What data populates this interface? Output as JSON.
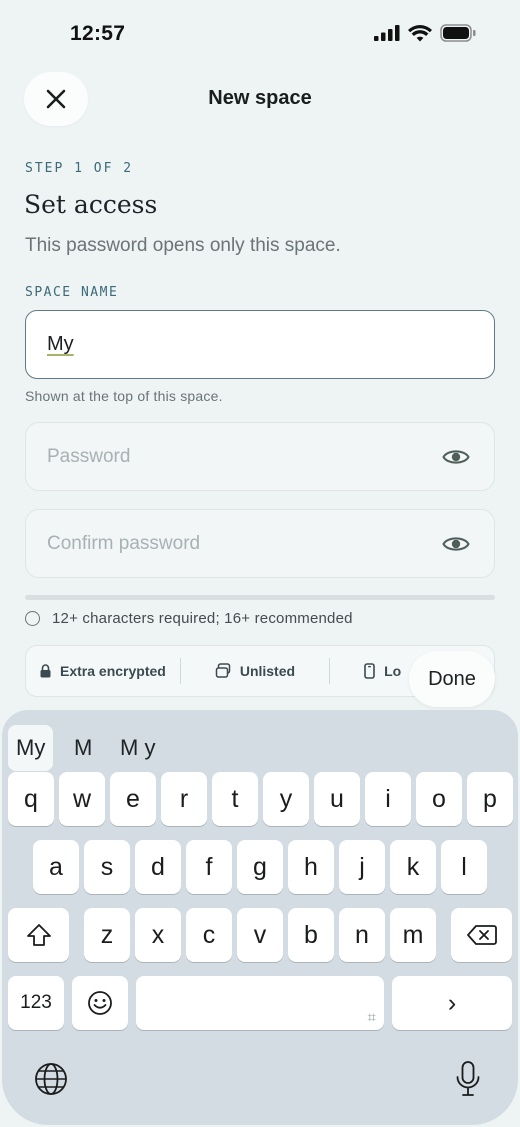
{
  "status_bar": {
    "time": "12:57"
  },
  "header": {
    "title": "New space"
  },
  "step": {
    "label": "STEP 1 OF 2",
    "heading": "Set access",
    "subtitle": "This password opens only this space."
  },
  "space_name": {
    "label": "SPACE NAME",
    "value": "My",
    "help": "Shown at the top of this space."
  },
  "password": {
    "placeholder": "Password"
  },
  "confirm_password": {
    "placeholder": "Confirm password"
  },
  "requirement": "12+ characters required; 16+ recommended",
  "features": [
    {
      "icon": "lock-icon",
      "label": "Extra encrypted"
    },
    {
      "icon": "stack-icon",
      "label": "Unlisted"
    },
    {
      "icon": "phone-icon",
      "label": "Lo"
    }
  ],
  "done_label": "Done",
  "keyboard": {
    "suggestions": [
      "My",
      "M",
      "M y"
    ],
    "row1": [
      "q",
      "w",
      "e",
      "r",
      "t",
      "y",
      "u",
      "i",
      "o",
      "p"
    ],
    "row2": [
      "a",
      "s",
      "d",
      "f",
      "g",
      "h",
      "j",
      "k",
      "l"
    ],
    "row3": [
      "z",
      "x",
      "c",
      "v",
      "b",
      "n",
      "m"
    ],
    "numbers_label": "123",
    "space_hint": "⌗",
    "return_label": "›"
  },
  "colors": {
    "accent": "#3b6a78",
    "background": "#eef3f4",
    "keyboard": "#d2dce2"
  }
}
